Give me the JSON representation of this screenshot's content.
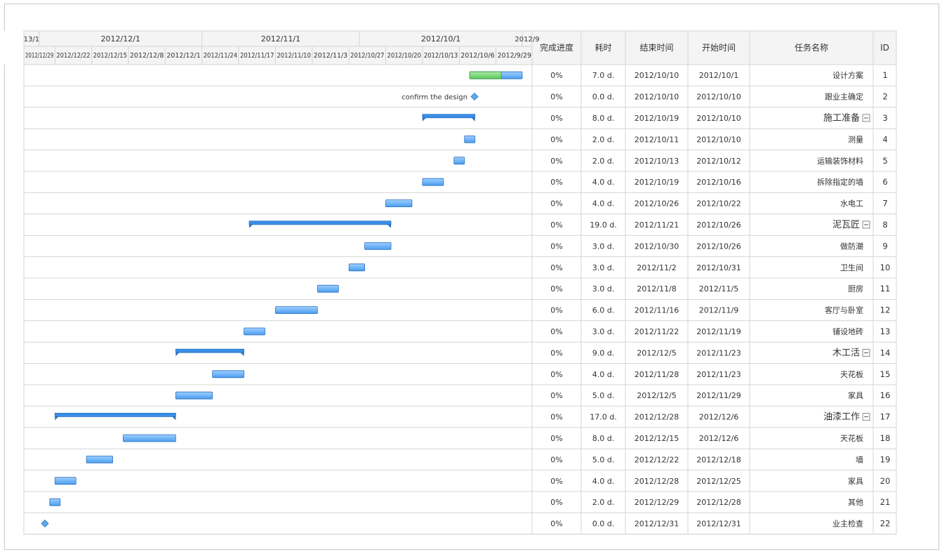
{
  "table": {
    "headers": {
      "id": "ID",
      "name": "任务名称",
      "start": "开始时间",
      "end": "结束时间",
      "duration": "耗时",
      "progress": "完成进度"
    },
    "rows": [
      {
        "id": "1",
        "name": "设计方案",
        "start": "2012/10/1",
        "end": "2012/10/10",
        "duration": "7.0 d.",
        "progress": "0%"
      },
      {
        "id": "2",
        "name": "跟业主确定",
        "start": "2012/10/10",
        "end": "2012/10/10",
        "duration": "0.0 d.",
        "progress": "0%"
      },
      {
        "id": "3",
        "name": "施工准备",
        "start": "2012/10/10",
        "end": "2012/10/19",
        "duration": "8.0 d.",
        "progress": "0%"
      },
      {
        "id": "4",
        "name": "测量",
        "start": "2012/10/10",
        "end": "2012/10/11",
        "duration": "2.0 d.",
        "progress": "0%"
      },
      {
        "id": "5",
        "name": "运输装饰材料",
        "start": "2012/10/12",
        "end": "2012/10/13",
        "duration": "2.0 d.",
        "progress": "0%"
      },
      {
        "id": "6",
        "name": "拆除指定的墙",
        "start": "2012/10/16",
        "end": "2012/10/19",
        "duration": "4.0 d.",
        "progress": "0%"
      },
      {
        "id": "7",
        "name": "水电工",
        "start": "2012/10/22",
        "end": "2012/10/26",
        "duration": "4.0 d.",
        "progress": "0%"
      },
      {
        "id": "8",
        "name": "泥瓦匠",
        "start": "2012/10/26",
        "end": "2012/11/21",
        "duration": "19.0 d.",
        "progress": "0%"
      },
      {
        "id": "9",
        "name": "做防潮",
        "start": "2012/10/26",
        "end": "2012/10/30",
        "duration": "3.0 d.",
        "progress": "0%"
      },
      {
        "id": "10",
        "name": "卫生间",
        "start": "2012/10/31",
        "end": "2012/11/2",
        "duration": "3.0 d.",
        "progress": "0%"
      },
      {
        "id": "11",
        "name": "厨房",
        "start": "2012/11/5",
        "end": "2012/11/8",
        "duration": "3.0 d.",
        "progress": "0%"
      },
      {
        "id": "12",
        "name": "客厅与卧室",
        "start": "2012/11/9",
        "end": "2012/11/16",
        "duration": "6.0 d.",
        "progress": "0%"
      },
      {
        "id": "13",
        "name": "铺设地砖",
        "start": "2012/11/19",
        "end": "2012/11/22",
        "duration": "3.0 d.",
        "progress": "0%"
      },
      {
        "id": "14",
        "name": "木工活",
        "start": "2012/11/23",
        "end": "2012/12/5",
        "duration": "9.0 d.",
        "progress": "0%"
      },
      {
        "id": "15",
        "name": "天花板",
        "start": "2012/11/23",
        "end": "2012/11/28",
        "duration": "4.0 d.",
        "progress": "0%"
      },
      {
        "id": "16",
        "name": "家具",
        "start": "2012/11/29",
        "end": "2012/12/5",
        "duration": "5.0 d.",
        "progress": "0%"
      },
      {
        "id": "17",
        "name": "油漆工作",
        "start": "2012/12/6",
        "end": "2012/12/28",
        "duration": "17.0 d.",
        "progress": "0%"
      },
      {
        "id": "18",
        "name": "天花板",
        "start": "2012/12/6",
        "end": "2012/12/15",
        "duration": "8.0 d.",
        "progress": "0%"
      },
      {
        "id": "19",
        "name": "墙",
        "start": "2012/12/18",
        "end": "2012/12/22",
        "duration": "5.0 d.",
        "progress": "0%"
      },
      {
        "id": "20",
        "name": "家具",
        "start": "2012/12/25",
        "end": "2012/12/28",
        "duration": "4.0 d.",
        "progress": "0%"
      },
      {
        "id": "21",
        "name": "其他",
        "start": "2012/12/28",
        "end": "2012/12/29",
        "duration": "2.0 d.",
        "progress": "0%"
      },
      {
        "id": "22",
        "name": "业主检查",
        "start": "2012/12/31",
        "end": "2012/12/31",
        "duration": "0.0 d.",
        "progress": "0%"
      }
    ]
  },
  "timeline": {
    "months": [
      "2012/9",
      "2012/10/1",
      "2012/11/1",
      "2012/12/1",
      "13/1"
    ],
    "weeks": [
      "2012/9/29",
      "2012/10/6",
      "2012/10/13",
      "2012/10/20",
      "2012/10/27",
      "2012/11/3",
      "2012/11/10",
      "2012/11/17",
      "2012/11/24",
      "2012/12/1",
      "2012/12/8",
      "2012/12/15",
      "2012/12/22",
      "2012/12/29"
    ],
    "milestone_label": "confirm the design"
  },
  "colors": {
    "bar_fill": "#4a9ef0",
    "bar_stroke": "#2a6fc0",
    "progress_fill": "#5dc85a",
    "summary": "#3a8ee6",
    "milestone": "#5aaaf0",
    "grid": "#d4d4d4",
    "header_bg": "#f4f4f4"
  }
}
